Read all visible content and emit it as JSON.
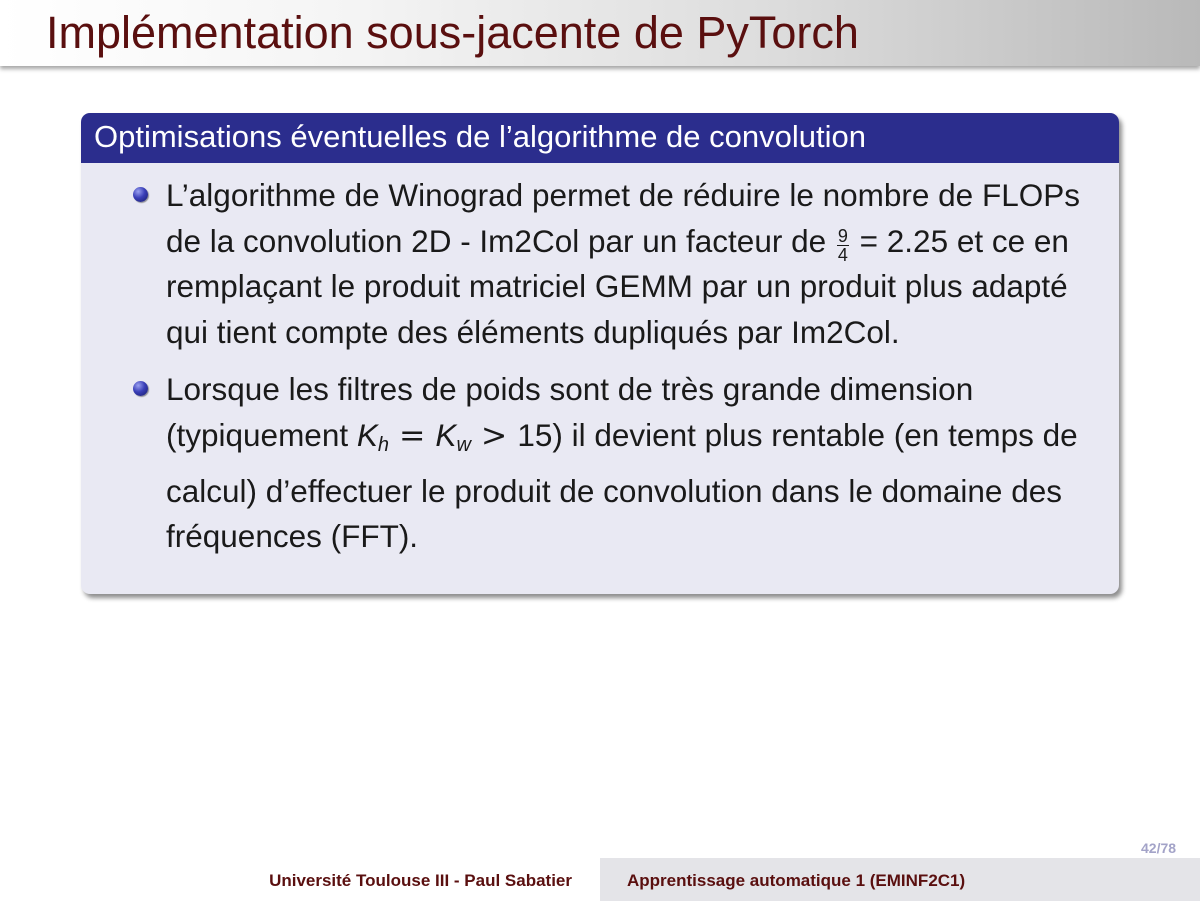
{
  "slide": {
    "title": "Implémentation sous-jacente de PyTorch"
  },
  "block": {
    "title": "Optimisations éventuelles de l’algorithme de convolution",
    "items": [
      {
        "text_before": "L’algorithme de Winograd permet de réduire le nombre de FLOPs de la convolution 2D - Im2Col par un facteur de ",
        "fraction_numerator": "9",
        "fraction_denominator": "4",
        "text_after": " = 2.25 et ce en remplaçant le produit matriciel GEMM par un produit plus adapté qui tient compte des éléments dupliqués par Im2Col."
      },
      {
        "text_before": "Lorsque les filtres de poids sont de très grande dimension (typiquement ",
        "var1": "K",
        "sub1": "h",
        "eq": " = ",
        "var2": "K",
        "sub2": "w",
        "gt": " > ",
        "text_after": "15) il devient plus rentable (en temps de calcul) d’effectuer le produit de convolution dans le domaine des fréquences (FFT)."
      }
    ]
  },
  "page_number": "42/78",
  "footer": {
    "left": "Université Toulouse III - Paul Sabatier",
    "right": "Apprentissage automatique 1 (EMINF2C1)"
  },
  "colors": {
    "title": "#5a0f0f",
    "block_header": "#2b2d8d",
    "block_body": "#e9e9f3",
    "bullet": "#3a3fb8"
  }
}
